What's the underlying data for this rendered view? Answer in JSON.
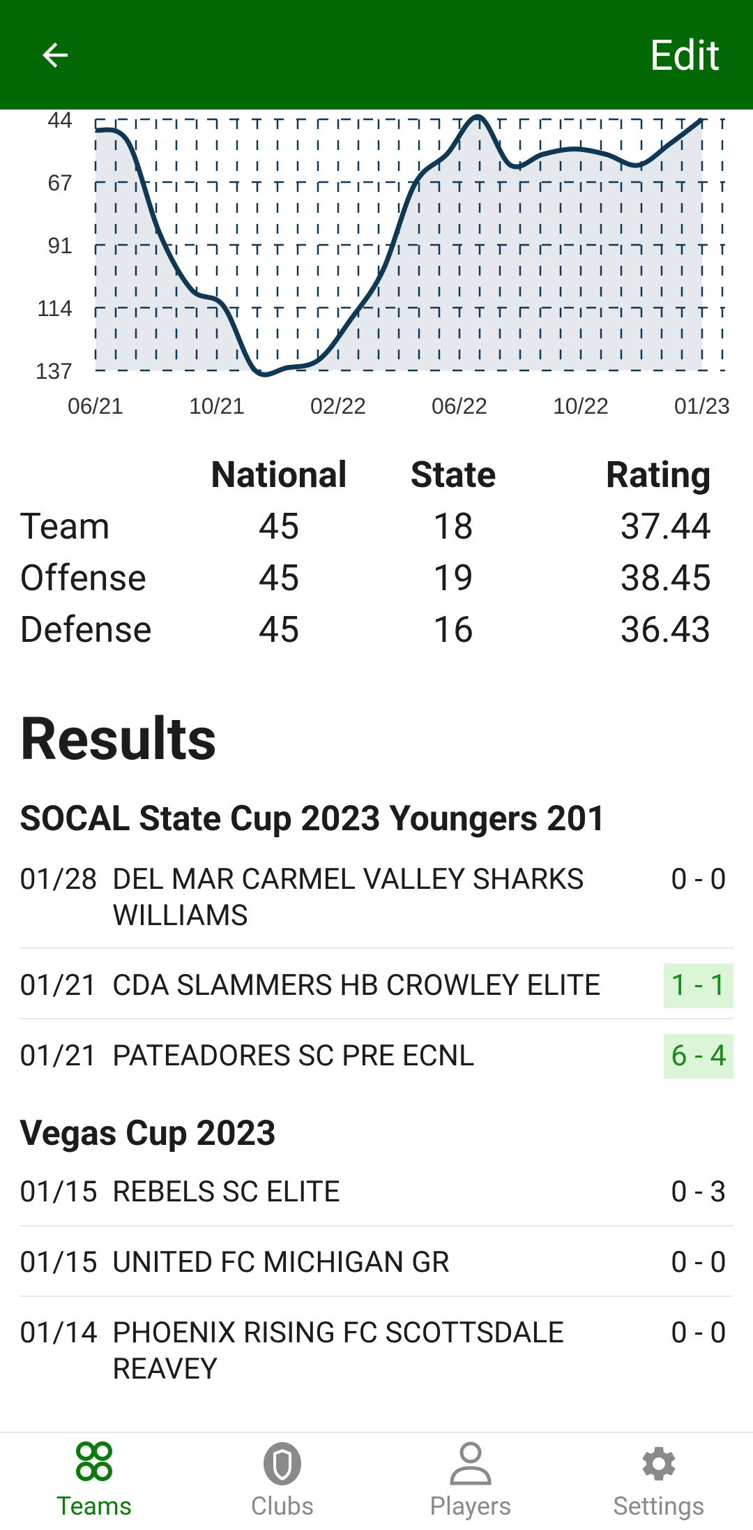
{
  "appbar": {
    "edit_label": "Edit"
  },
  "chart_data": {
    "type": "area",
    "y_ticks": [
      "44",
      "67",
      "91",
      "114",
      "137"
    ],
    "x_ticks": [
      "06/21",
      "10/21",
      "02/22",
      "06/22",
      "10/22",
      "01/23"
    ],
    "ylim": [
      44,
      137
    ],
    "y_inverted": true,
    "grid": "dashed",
    "series": [
      {
        "x": [
          "06/21",
          "07/21",
          "08/21",
          "09/21",
          "10/21",
          "11/21",
          "12/21",
          "01/22",
          "02/22",
          "03/22",
          "04/22",
          "05/22",
          "06/22",
          "07/22",
          "08/22",
          "09/22",
          "10/22",
          "11/22",
          "12/22",
          "01/23"
        ],
        "values": [
          48,
          52,
          86,
          107,
          113,
          137,
          136,
          133,
          118,
          100,
          68,
          57,
          43,
          61,
          57,
          55,
          57,
          61,
          53,
          44
        ]
      }
    ],
    "line_color": "#0e3853",
    "fill_color": "#e5e8ec"
  },
  "stats": {
    "headers": [
      "National",
      "State",
      "Rating"
    ],
    "rows": [
      {
        "label": "Team",
        "national": "45",
        "state": "18",
        "rating": "37.44"
      },
      {
        "label": "Offense",
        "national": "45",
        "state": "19",
        "rating": "38.45"
      },
      {
        "label": "Defense",
        "national": "45",
        "state": "16",
        "rating": "36.43"
      }
    ]
  },
  "results": {
    "title": "Results",
    "groups": [
      {
        "title": "SOCAL State Cup 2023 Youngers 201",
        "matches": [
          {
            "date": "01/28",
            "opponent": "DEL MAR CARMEL VALLEY SHARKS WILLIAMS",
            "score": "0 - 0"
          },
          {
            "date": "01/21",
            "opponent": "CDA SLAMMERS HB CROWLEY ELITE",
            "score": "1 - 1"
          },
          {
            "date": "01/21",
            "opponent": "PATEADORES SC PRE ECNL",
            "score": "6 - 4"
          }
        ]
      },
      {
        "title": "Vegas Cup 2023",
        "matches": [
          {
            "date": "01/15",
            "opponent": "REBELS SC ELITE",
            "score": "0 - 3"
          },
          {
            "date": "01/15",
            "opponent": "UNITED FC MICHIGAN GR",
            "score": "0 - 0"
          },
          {
            "date": "01/14",
            "opponent": "PHOENIX RISING FC SCOTTSDALE REAVEY",
            "score": "0 - 0"
          }
        ]
      }
    ]
  },
  "nav": {
    "items": [
      {
        "label": "Teams",
        "icon": "teams-icon",
        "active": true
      },
      {
        "label": "Clubs",
        "icon": "clubs-icon"
      },
      {
        "label": "Players",
        "icon": "players-icon"
      },
      {
        "label": "Settings",
        "icon": "settings-icon"
      }
    ],
    "active_color": "#0c7a0c",
    "inactive_color": "#8a8a8a"
  }
}
